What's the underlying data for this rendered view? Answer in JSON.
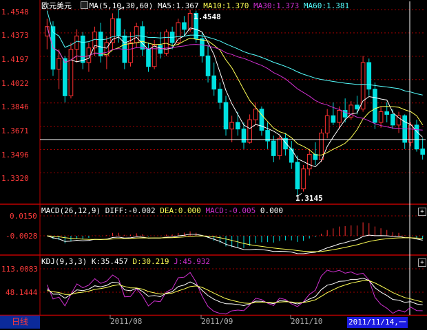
{
  "main": {
    "symbol": "欧元美元",
    "ma_label": "MA(5,10,30,60)",
    "ma5": "MA5:1.367",
    "ma10": "MA10:1.370",
    "ma30": "MA30:1.373",
    "ma60": "MA60:1.381",
    "y_ticks": [
      "1.4548",
      "1.4373",
      "1.4197",
      "1.4022",
      "1.3846",
      "1.3671",
      "1.3496",
      "1.3320"
    ],
    "high_label": "1.4548",
    "low_label": "1.3145"
  },
  "macd": {
    "title": "MACD(26,12,9)",
    "diff": "DIFF:-0.002",
    "dea": "DEA:0.000",
    "macd": "MACD:-0.005",
    "extra": "0.000",
    "y_ticks": [
      "0.0150",
      "-0.0028"
    ]
  },
  "kdj": {
    "title": "KDJ(9,3,3)",
    "k": "K:35.457",
    "d": "D:30.219",
    "j": "J:45.932",
    "y_ticks": [
      "113.0083",
      "48.1444"
    ]
  },
  "footer": {
    "period_tab": "日线",
    "dates": [
      "2011/08",
      "2011/09",
      "2011/10"
    ],
    "cursor_date": "2011/11/14,一"
  },
  "buttons": {
    "plus": "+"
  },
  "colors": {
    "up": "#ff3030",
    "down": "#00e0e0",
    "ma5": "#ffffff",
    "ma10": "#ffff55",
    "ma30": "#d030d0",
    "ma60": "#55ffff",
    "grid": "#a00000",
    "border": "#c00000"
  },
  "chart_data": {
    "type": "candlestick",
    "series_main": [
      {
        "name": "MA5",
        "color": "#ffffff"
      },
      {
        "name": "MA10",
        "color": "#ffff55"
      },
      {
        "name": "MA30",
        "color": "#d030d0"
      },
      {
        "name": "MA60",
        "color": "#55ffff"
      }
    ],
    "ohlc": [
      [
        1.435,
        1.448,
        1.425,
        1.442
      ],
      [
        1.442,
        1.446,
        1.405,
        1.41
      ],
      [
        1.41,
        1.425,
        1.395,
        1.418
      ],
      [
        1.418,
        1.42,
        1.385,
        1.39
      ],
      [
        1.39,
        1.43,
        1.388,
        1.425
      ],
      [
        1.425,
        1.44,
        1.415,
        1.435
      ],
      [
        1.435,
        1.438,
        1.41,
        1.415
      ],
      [
        1.415,
        1.43,
        1.408,
        1.426
      ],
      [
        1.426,
        1.442,
        1.42,
        1.438
      ],
      [
        1.438,
        1.445,
        1.415,
        1.42
      ],
      [
        1.42,
        1.435,
        1.41,
        1.43
      ],
      [
        1.43,
        1.452,
        1.425,
        1.448
      ],
      [
        1.448,
        1.4548,
        1.43,
        1.435
      ],
      [
        1.435,
        1.44,
        1.41,
        1.415
      ],
      [
        1.415,
        1.438,
        1.412,
        1.43
      ],
      [
        1.43,
        1.445,
        1.426,
        1.442
      ],
      [
        1.442,
        1.446,
        1.42,
        1.425
      ],
      [
        1.425,
        1.43,
        1.408,
        1.412
      ],
      [
        1.412,
        1.432,
        1.41,
        1.428
      ],
      [
        1.428,
        1.438,
        1.418,
        1.422
      ],
      [
        1.422,
        1.44,
        1.42,
        1.438
      ],
      [
        1.438,
        1.442,
        1.425,
        1.43
      ],
      [
        1.43,
        1.448,
        1.428,
        1.445
      ],
      [
        1.445,
        1.45,
        1.435,
        1.44
      ],
      [
        1.44,
        1.4548,
        1.438,
        1.452
      ],
      [
        1.452,
        1.454,
        1.43,
        1.433
      ],
      [
        1.433,
        1.438,
        1.415,
        1.42
      ],
      [
        1.42,
        1.428,
        1.4,
        1.405
      ],
      [
        1.405,
        1.415,
        1.39,
        1.395
      ],
      [
        1.395,
        1.4,
        1.38,
        1.385
      ],
      [
        1.385,
        1.39,
        1.36,
        1.365
      ],
      [
        1.365,
        1.375,
        1.355,
        1.37
      ],
      [
        1.37,
        1.378,
        1.36,
        1.365
      ],
      [
        1.365,
        1.37,
        1.35,
        1.355
      ],
      [
        1.355,
        1.376,
        1.354,
        1.372
      ],
      [
        1.372,
        1.385,
        1.368,
        1.38
      ],
      [
        1.38,
        1.382,
        1.36,
        1.364
      ],
      [
        1.364,
        1.37,
        1.35,
        1.356
      ],
      [
        1.356,
        1.36,
        1.34,
        1.345
      ],
      [
        1.345,
        1.36,
        1.342,
        1.358
      ],
      [
        1.358,
        1.362,
        1.345,
        1.35
      ],
      [
        1.35,
        1.356,
        1.335,
        1.34
      ],
      [
        1.34,
        1.345,
        1.3145,
        1.32
      ],
      [
        1.32,
        1.338,
        1.318,
        1.335
      ],
      [
        1.335,
        1.35,
        1.33,
        1.346
      ],
      [
        1.346,
        1.355,
        1.338,
        1.342
      ],
      [
        1.342,
        1.365,
        1.34,
        1.362
      ],
      [
        1.362,
        1.38,
        1.358,
        1.375
      ],
      [
        1.375,
        1.385,
        1.368,
        1.37
      ],
      [
        1.37,
        1.382,
        1.365,
        1.379
      ],
      [
        1.379,
        1.388,
        1.37,
        1.374
      ],
      [
        1.374,
        1.386,
        1.372,
        1.383
      ],
      [
        1.383,
        1.39,
        1.376,
        1.38
      ],
      [
        1.38,
        1.42,
        1.378,
        1.415
      ],
      [
        1.415,
        1.418,
        1.39,
        1.395
      ],
      [
        1.395,
        1.4,
        1.365,
        1.37
      ],
      [
        1.37,
        1.382,
        1.366,
        1.378
      ],
      [
        1.378,
        1.385,
        1.37,
        1.376
      ],
      [
        1.376,
        1.38,
        1.365,
        1.368
      ],
      [
        1.368,
        1.378,
        1.362,
        1.375
      ],
      [
        1.375,
        1.376,
        1.35,
        1.355
      ],
      [
        1.355,
        1.37,
        1.352,
        1.368
      ],
      [
        1.368,
        1.372,
        1.348,
        1.35
      ],
      [
        1.35,
        1.358,
        1.342,
        1.346
      ]
    ]
  }
}
